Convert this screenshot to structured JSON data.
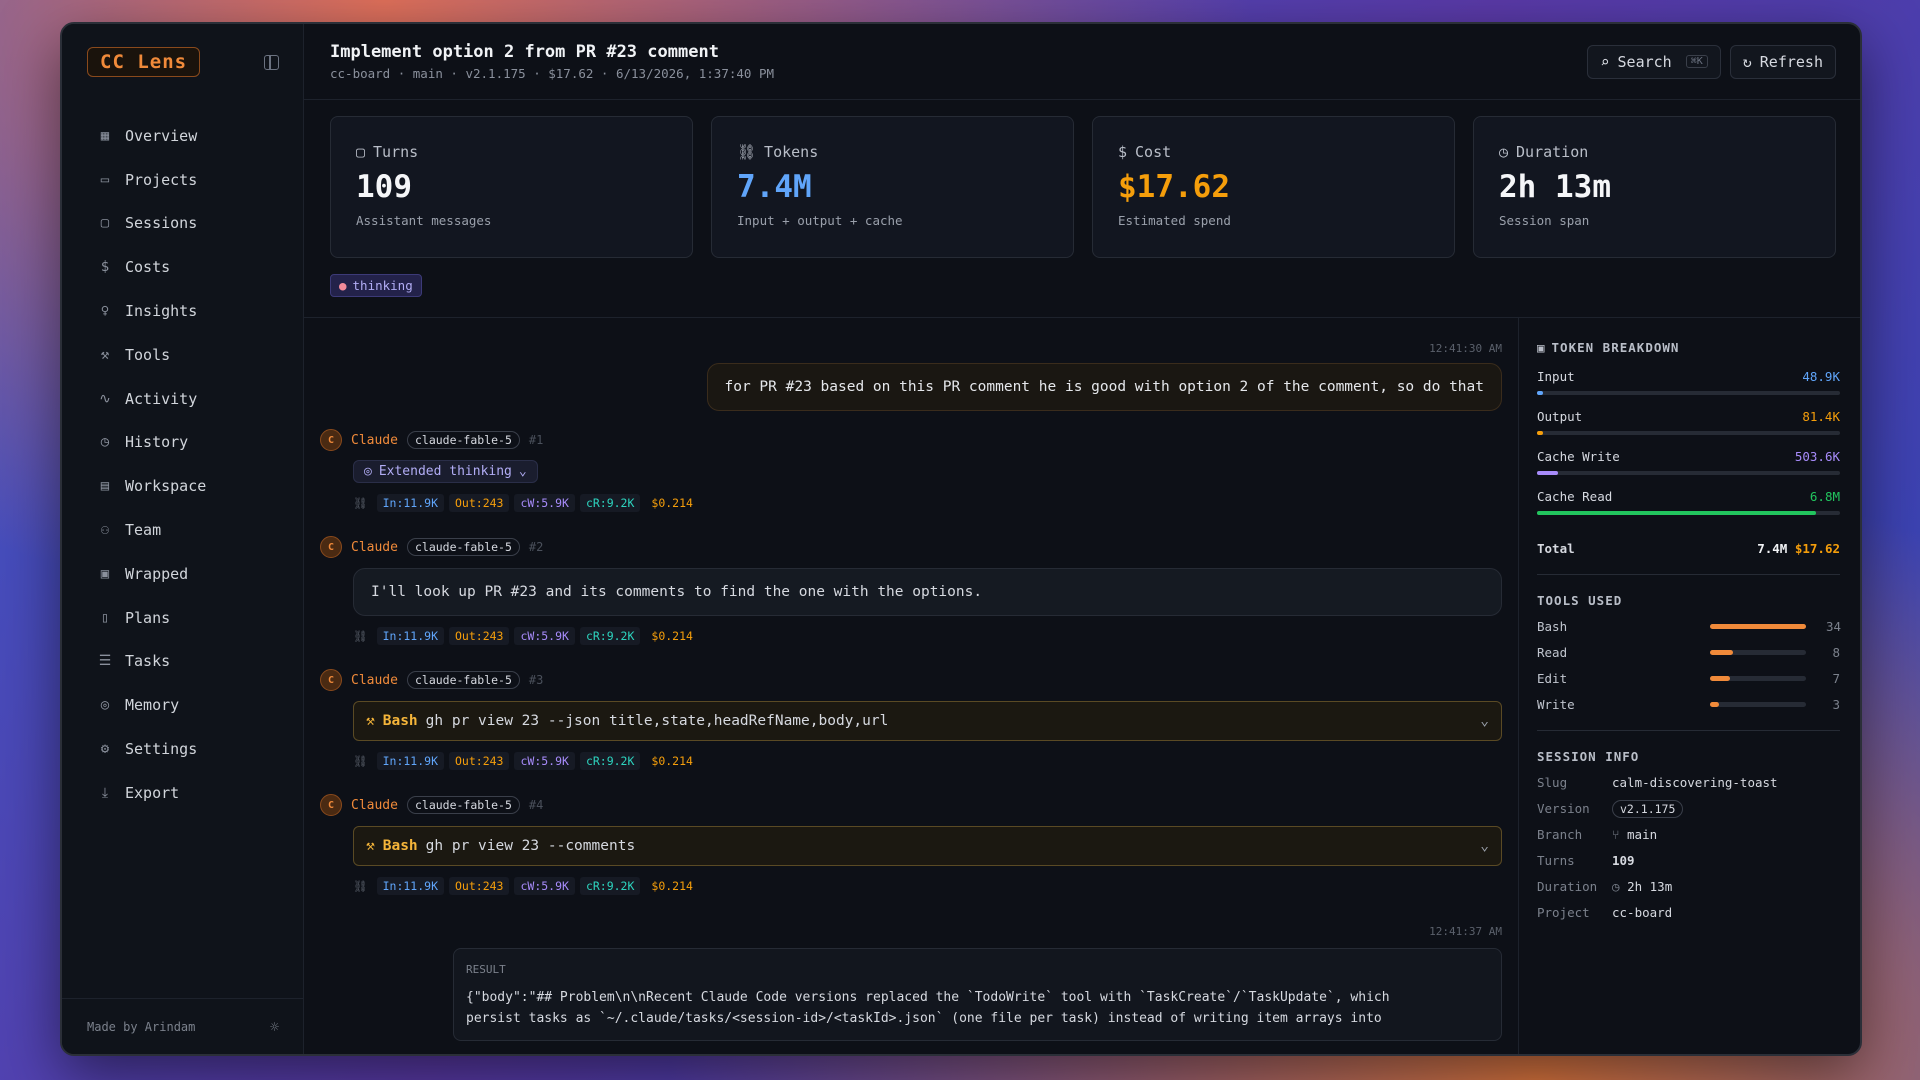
{
  "app": {
    "brand": "CC Lens",
    "footer": "Made by Arindam"
  },
  "nav": [
    {
      "label": "Overview",
      "icon": "grid-icon"
    },
    {
      "label": "Projects",
      "icon": "folder-icon"
    },
    {
      "label": "Sessions",
      "icon": "chat-icon"
    },
    {
      "label": "Costs",
      "icon": "dollar-icon"
    },
    {
      "label": "Insights",
      "icon": "lightbulb-icon"
    },
    {
      "label": "Tools",
      "icon": "wrench-icon"
    },
    {
      "label": "Activity",
      "icon": "activity-icon"
    },
    {
      "label": "History",
      "icon": "history-icon"
    },
    {
      "label": "Workspace",
      "icon": "workspace-icon"
    },
    {
      "label": "Team",
      "icon": "team-icon"
    },
    {
      "label": "Wrapped",
      "icon": "gift-icon"
    },
    {
      "label": "Plans",
      "icon": "document-icon"
    },
    {
      "label": "Tasks",
      "icon": "tasks-icon"
    },
    {
      "label": "Memory",
      "icon": "brain-icon"
    },
    {
      "label": "Settings",
      "icon": "gear-icon"
    },
    {
      "label": "Export",
      "icon": "download-icon"
    }
  ],
  "header": {
    "title": "Implement option 2 from PR #23 comment",
    "subtitle": "cc-board · main · v2.1.175 · $17.62 · 6/13/2026, 1:37:40 PM",
    "search": "Search",
    "search_kbd": "⌘K",
    "refresh": "Refresh"
  },
  "stats": [
    {
      "label": "Turns",
      "value": "109",
      "sub": "Assistant messages",
      "color": "#f5f6f8"
    },
    {
      "label": "Tokens",
      "value": "7.4M",
      "sub": "Input + output + cache",
      "color": "#60a5fa"
    },
    {
      "label": "Cost",
      "value": "$17.62",
      "sub": "Estimated spend",
      "color": "#f59e0b"
    },
    {
      "label": "Duration",
      "value": "2h 13m",
      "sub": "Session span",
      "color": "#f5f6f8"
    }
  ],
  "tag": "thinking",
  "chat": {
    "ts1": "12:41:30 AM",
    "user_msg": "for PR #23 based on this PR comment he is good with option 2 of the comment, so do that",
    "who": "Claude",
    "model": "claude-fable-5",
    "ext_thinking": "Extended thinking",
    "metrics": {
      "in": "In:11.9K",
      "out": "Out:243",
      "cw": "cW:5.9K",
      "cr": "cR:9.2K",
      "cost": "$0.214"
    },
    "turns": [
      {
        "num": "#1"
      },
      {
        "num": "#2",
        "text": "I'll look up PR #23 and its comments to find the one with the options."
      },
      {
        "num": "#3",
        "tool": "Bash",
        "cmd": "gh pr view 23 --json title,state,headRefName,body,url"
      },
      {
        "num": "#4",
        "tool": "Bash",
        "cmd": "gh pr view 23 --comments"
      }
    ],
    "ts2": "12:41:37 AM",
    "result_label": "RESULT",
    "result_line1": "{\"body\":\"## Problem\\n\\nRecent Claude Code versions replaced the `TodoWrite` tool with `TaskCreate`/`TaskUpdate`, which",
    "result_line2": "persist tasks as `~/.claude/tasks/<session-id>/<taskId>.json` (one file per task) instead of writing item arrays into"
  },
  "token_breakdown": {
    "title": "TOKEN BREAKDOWN",
    "rows": [
      {
        "label": "Input",
        "value": "48.9K",
        "color": "#60a5fa",
        "fraction": 0.02
      },
      {
        "label": "Output",
        "value": "81.4K",
        "color": "#f59e0b",
        "fraction": 0.02
      },
      {
        "label": "Cache Write",
        "value": "503.6K",
        "color": "#a78bfa",
        "fraction": 0.07
      },
      {
        "label": "Cache Read",
        "value": "6.8M",
        "color": "#22c55e",
        "fraction": 0.92
      }
    ],
    "total_label": "Total",
    "total_tokens": "7.4M",
    "total_cost": "$17.62"
  },
  "tools_used": {
    "title": "TOOLS USED",
    "rows": [
      {
        "name": "Bash",
        "count": "34",
        "fraction": 1.0
      },
      {
        "name": "Read",
        "count": "8",
        "fraction": 0.24
      },
      {
        "name": "Edit",
        "count": "7",
        "fraction": 0.21
      },
      {
        "name": "Write",
        "count": "3",
        "fraction": 0.09
      }
    ]
  },
  "session_info": {
    "title": "SESSION INFO",
    "slug_k": "Slug",
    "slug": "calm-discovering-toast",
    "version_k": "Version",
    "version": "v2.1.175",
    "branch_k": "Branch",
    "branch": "main",
    "turns_k": "Turns",
    "turns": "109",
    "duration_k": "Duration",
    "duration": "2h 13m",
    "project_k": "Project",
    "project": "cc-board"
  }
}
